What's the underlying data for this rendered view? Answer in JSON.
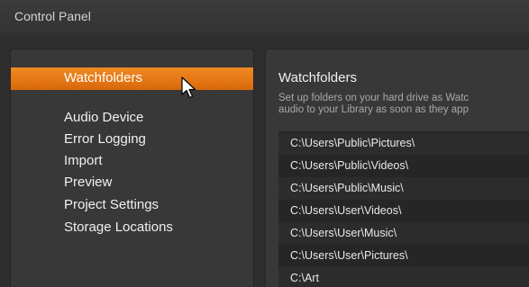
{
  "window": {
    "title": "Control Panel"
  },
  "sidebar": {
    "items": [
      {
        "label": "Watchfolders",
        "selected": true
      },
      {
        "label": "Audio Device"
      },
      {
        "label": "Error Logging"
      },
      {
        "label": "Import"
      },
      {
        "label": "Preview"
      },
      {
        "label": "Project Settings"
      },
      {
        "label": "Storage Locations"
      }
    ]
  },
  "main": {
    "title": "Watchfolders",
    "description_line1": "Set up folders on your hard drive as Watc",
    "description_line2": "audio to your Library as soon as they app",
    "folders": [
      "C:\\Users\\Public\\Pictures\\",
      "C:\\Users\\Public\\Videos\\",
      "C:\\Users\\Public\\Music\\",
      "C:\\Users\\User\\Videos\\",
      "C:\\Users\\User\\Music\\",
      "C:\\Users\\User\\Pictures\\",
      "C:\\Art"
    ]
  },
  "colors": {
    "accent": "#e67a1a",
    "window_bg": "#2e2e2e",
    "panel_bg": "#383838",
    "list_bg": "#2c2c2c"
  },
  "icons": {
    "cursor": "mouse-pointer-icon"
  }
}
